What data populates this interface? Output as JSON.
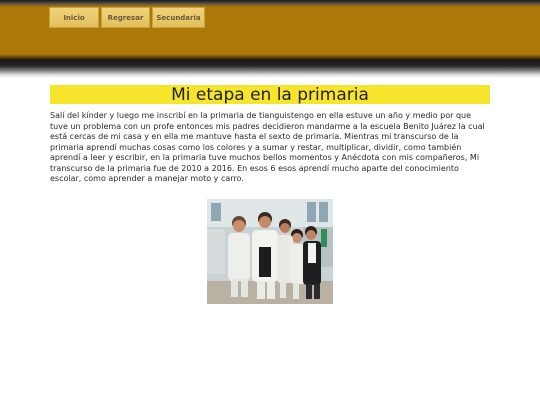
{
  "nav": {
    "items": [
      {
        "label": "Inicio"
      },
      {
        "label": "Regresar"
      },
      {
        "label": "Secundaria"
      }
    ]
  },
  "page": {
    "title": "Mi etapa en la primaria",
    "paragraph": "Salí del kínder y luego me inscribí en la primaria de tianguistengo en ella estuve un año y medio por que tuve un problema con un profe entonces mis padres decidieron mandarme a la escuela Benito Juárez la cual está cercas de mi casa y en ella me mantuve hasta el sexto de primaria. Mientras mi transcurso de la primaria aprendí muchas cosas como los colores y a sumar y restar, multiplicar, dividir, como también aprendí a leer y escribir, en la primaria tuve muchos bellos momentos y Anécdota con mis compañeros, Mi transcurso de la primaria fue de 2010 a 2016. En esos 6 esos aprendí mucho aparte del conocimiento escolar, como aprender a manejar moto y carro."
  },
  "colors": {
    "header_brown": "#ad7a0a",
    "nav_button": "#e8c86a",
    "title_bg": "#f7e52c"
  }
}
